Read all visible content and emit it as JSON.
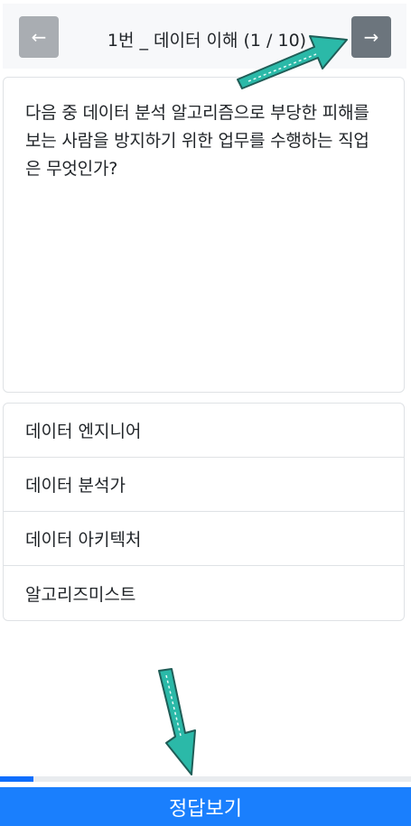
{
  "header": {
    "prev_icon": "←",
    "next_icon": "→",
    "title": "1번 _ 데이터 이해 (1 / 10)"
  },
  "question": {
    "text": "다음 중 데이터 분석 알고리즘으로 부당한 피해를 보는 사람을 방지하기 위한 업무를 수행하는 직업은 무엇인가?"
  },
  "options": [
    {
      "label": "데이터 엔지니어"
    },
    {
      "label": "데이터 분석가"
    },
    {
      "label": "데이터 아키텍처"
    },
    {
      "label": "알고리즈미스트"
    }
  ],
  "progress": {
    "fraction": 0.1
  },
  "answer_button": {
    "label": "정답보기"
  },
  "annotations": {
    "arrow_icons": [
      "right-arrow-icon",
      "down-arrow-icon"
    ],
    "arrow_color": "#2bb9a8"
  }
}
